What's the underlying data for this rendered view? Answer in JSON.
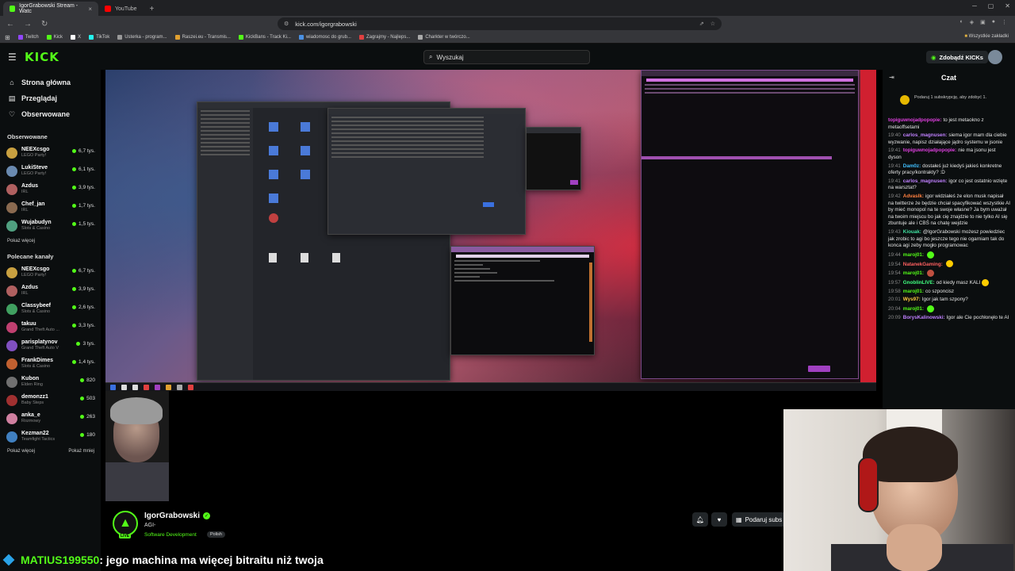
{
  "browser": {
    "tabs": [
      {
        "title": "IgorGrabowski Stream - Watc",
        "active": true,
        "color": "#53fc18"
      },
      {
        "title": "YouTube",
        "active": false,
        "color": "#ff0000"
      }
    ],
    "url": "kick.com/igorgrabowski",
    "bookmarks": [
      {
        "label": "Twitch",
        "color": "#9146ff"
      },
      {
        "label": "Kick",
        "color": "#53fc18"
      },
      {
        "label": "X",
        "color": "#ffffff"
      },
      {
        "label": "TikTok",
        "color": "#25f4ee"
      },
      {
        "label": "Usterka - program...",
        "color": "#999999"
      },
      {
        "label": "Raszei.eu - Transmis...",
        "color": "#e0a030"
      },
      {
        "label": "KickBans - Track Ki...",
        "color": "#53fc18"
      },
      {
        "label": "wiadomosc do grub...",
        "color": "#4a90e2"
      },
      {
        "label": "Zagrajmy - Najleps...",
        "color": "#e04040"
      },
      {
        "label": "Charkter w twórczo...",
        "color": "#aaaaaa"
      }
    ],
    "bookmarks_folder": "Wszystkie zakładki"
  },
  "header": {
    "logo": "KICK",
    "search_placeholder": "Wyszukaj",
    "kicks_button": "Zdobądź KICKs"
  },
  "sidebar": {
    "nav": [
      {
        "label": "Strona główna",
        "icon": "home-icon"
      },
      {
        "label": "Przeglądaj",
        "icon": "browse-icon"
      },
      {
        "label": "Obserwowane",
        "icon": "heart-icon"
      }
    ],
    "followed_title": "Obserwowane",
    "followed": [
      {
        "name": "NEEXcsgo",
        "category": "LEGO Party!",
        "viewers": "6,7 tys.",
        "color": "#c8a040"
      },
      {
        "name": "LukiSteve",
        "category": "LEGO Party!",
        "viewers": "6,1 tys.",
        "color": "#6a8ab0"
      },
      {
        "name": "Azdus",
        "category": "IRL",
        "viewers": "3,9 tys.",
        "color": "#b06060"
      },
      {
        "name": "Chef_jan",
        "category": "IRL",
        "viewers": "1,7 tys.",
        "color": "#8a6a50"
      },
      {
        "name": "Wujabudyn",
        "category": "Slots & Casino",
        "viewers": "1,5 tys.",
        "color": "#50a080"
      }
    ],
    "show_more": "Pokaż więcej",
    "recommended_title": "Polecane kanały",
    "recommended": [
      {
        "name": "NEEXcsgo",
        "category": "LEGO Party!",
        "viewers": "6,7 tys.",
        "color": "#c8a040"
      },
      {
        "name": "Azdus",
        "category": "IRL",
        "viewers": "3,9 tys.",
        "color": "#b06060"
      },
      {
        "name": "Classybeef",
        "category": "Slots & Casino",
        "viewers": "2,6 tys.",
        "color": "#40a060"
      },
      {
        "name": "takuu",
        "category": "Grand Theft Auto ...",
        "viewers": "3,3 tys.",
        "color": "#c04070"
      },
      {
        "name": "parisplatynov",
        "category": "Grand Theft Auto V",
        "viewers": "3 tys.",
        "color": "#8050c0"
      },
      {
        "name": "FrankDimes",
        "category": "Slots & Casino",
        "viewers": "1,4 tys.",
        "color": "#c06030"
      },
      {
        "name": "Kubon",
        "category": "Elden Ring",
        "viewers": "820",
        "color": "#707070"
      },
      {
        "name": "demonzz1",
        "category": "Baby Steps",
        "viewers": "503",
        "color": "#a03030"
      },
      {
        "name": "anka_e",
        "category": "Rozmowy",
        "viewers": "263",
        "color": "#d080a0"
      },
      {
        "name": "Kezman22",
        "category": "Teamfight Tactics",
        "viewers": "180",
        "color": "#4080c0"
      }
    ],
    "show_more_2": "Pokaż więcej",
    "show_less": "Pokaż mniej"
  },
  "streamer": {
    "name": "IgorGrabowski",
    "title": "AGI-",
    "category": "Software Development",
    "tag": "Polish",
    "live_badge": "LIVE",
    "gift_button": "Podaruj subs"
  },
  "chat": {
    "title": "Czat",
    "pinned": "Podaruj 1 subskrypcję, aby zdobyć 1.",
    "messages": [
      {
        "time": "",
        "user": "topiguwnojadpopopie:",
        "color": "#e040e0",
        "text": "to jest metaokno z metaoffsetami"
      },
      {
        "time": "19:40",
        "user": "carlos_magnusen:",
        "color": "#c080ff",
        "text": "siema igor mam dla ciebie wyzwanie, napisz działające jądro systemu w jsonie"
      },
      {
        "time": "19:41",
        "user": "topiguwnojadpopopie:",
        "color": "#e040e0",
        "text": "nie ma jsonu jest dyson"
      },
      {
        "time": "19:41",
        "user": "Dam0z:",
        "color": "#40c0ff",
        "text": "dostałeś już kiedyś jakieś konkretne oferty pracy/kontrakty? :D"
      },
      {
        "time": "19:41",
        "user": "carlos_magnusen:",
        "color": "#c080ff",
        "text": "igor co jest ostatnio wzięte na warsztat?"
      },
      {
        "time": "19:42",
        "user": "Advaslk:",
        "color": "#ff8040",
        "text": "igor widziałeś że elon musk napisał na twitterze że będzie chciał spacyfikować wszystkie AI by mieć monopol na te swoje własne? Ja bym uważał na twoim miejscu bo jak cię znajdzie to nie tylko AI się zbuntuje ale i CBŚ na chatę wejdzie"
      },
      {
        "time": "19:43",
        "user": "Kiouak:",
        "color": "#40e0a0",
        "text": "@IgorGrabowski możesz powiedziec jak zrobic to agi bo jeszcze tego nie ogarniam tak do konca agi zeby mogło programowac"
      },
      {
        "time": "19:44",
        "user": "maroj01:",
        "color": "#53fc18",
        "text": "",
        "emote": "#53fc18"
      },
      {
        "time": "19:54",
        "user": "NatanekGaming:",
        "color": "#ff6060",
        "text": "",
        "emote": "#ffcc00"
      },
      {
        "time": "19:54",
        "user": "maroj01:",
        "color": "#53fc18",
        "text": "",
        "emote": "#c05040"
      },
      {
        "time": "19:57",
        "user": "GnoblinLIVE:",
        "color": "#40ff80",
        "text": "od kiedy masz KALI",
        "emote": "#ffcc00"
      },
      {
        "time": "19:58",
        "user": "maroj01:",
        "color": "#53fc18",
        "text": "co szponcisz"
      },
      {
        "time": "20:01",
        "user": "Wys97:",
        "color": "#ffcc40",
        "text": "Igor jak tam szpony?"
      },
      {
        "time": "20:04",
        "user": "maroj01:",
        "color": "#53fc18",
        "text": "",
        "emote": "#53fc18"
      },
      {
        "time": "20:09",
        "user": "BorysKalinowski:",
        "color": "#c080ff",
        "text": "Igor ale Cie pochłonęło te AI"
      }
    ]
  },
  "overlay": {
    "user": "MATIUS199550",
    "text": ": jego machina ma więcej bitraitu niż twoja"
  }
}
